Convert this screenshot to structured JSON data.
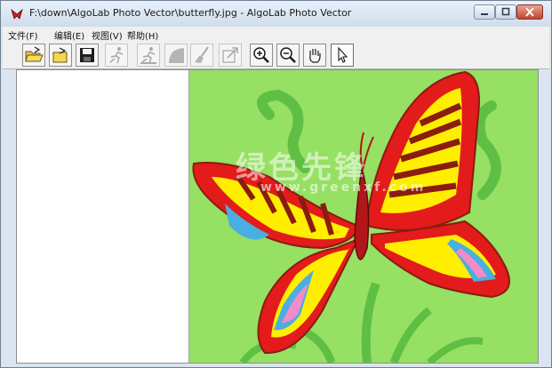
{
  "window": {
    "title": "F:\\down\\AlgoLab Photo Vector\\butterfly.jpg - AlgoLab Photo Vector",
    "icon": "app-icon",
    "controls": [
      "minimize-icon",
      "maximize-icon",
      "close-icon"
    ]
  },
  "menubar": {
    "items": [
      {
        "label": "文件(F)"
      },
      {
        "label": "编辑(E)"
      },
      {
        "label": "视图(V)"
      },
      {
        "label": "帮助(H)"
      }
    ]
  },
  "toolbar": {
    "buttons": [
      {
        "icon": "open-folder-icon",
        "enabled": true
      },
      {
        "icon": "open-image-icon",
        "enabled": true
      },
      {
        "icon": "save-icon",
        "enabled": true
      },
      {
        "icon": "run-icon",
        "enabled": false
      },
      {
        "icon": "run-step-icon",
        "enabled": false
      },
      {
        "icon": "fill-shape-icon",
        "enabled": false
      },
      {
        "icon": "brush-icon",
        "enabled": false
      },
      {
        "icon": "export-icon",
        "enabled": false
      },
      {
        "icon": "zoom-in-icon",
        "enabled": true
      },
      {
        "icon": "zoom-out-icon",
        "enabled": true
      },
      {
        "icon": "hand-pan-icon",
        "enabled": true
      },
      {
        "icon": "pointer-icon",
        "enabled": true,
        "selected": true
      }
    ]
  },
  "canvas": {
    "image": "butterfly",
    "background_color": "#96e063",
    "watermark": "绿色先锋",
    "watermark_url": "www.greenxf.com"
  },
  "colors": {
    "butterfly_red": "#e31b1b",
    "butterfly_yellow": "#ffee00",
    "butterfly_brown": "#8a1c10",
    "butterfly_blue": "#4aaee0",
    "butterfly_pink": "#f28bc8",
    "stem_green": "#5fbf45"
  }
}
